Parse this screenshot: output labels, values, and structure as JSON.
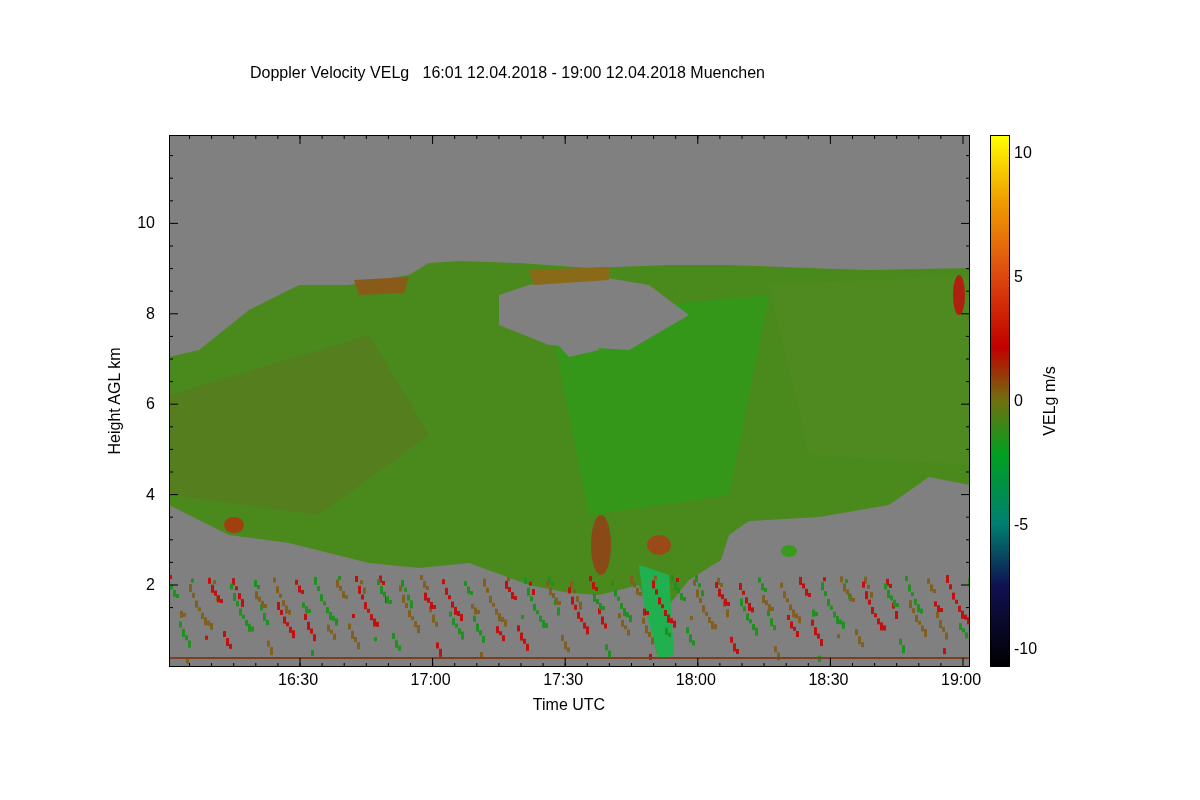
{
  "title": "Doppler Velocity VELg   16:01 12.04.2018 - 19:00 12.04.2018 Muenchen",
  "y_axis": {
    "label": "Height AGL km",
    "ticks": [
      "10",
      "8",
      "6",
      "4",
      "2"
    ]
  },
  "x_axis": {
    "label": "Time UTC",
    "ticks": [
      "16:30",
      "17:00",
      "17:30",
      "18:00",
      "18:30",
      "19:00"
    ]
  },
  "colorbar": {
    "label": "VELg m/s",
    "ticks": [
      "10",
      "5",
      "0",
      "-5",
      "-10"
    ]
  }
}
